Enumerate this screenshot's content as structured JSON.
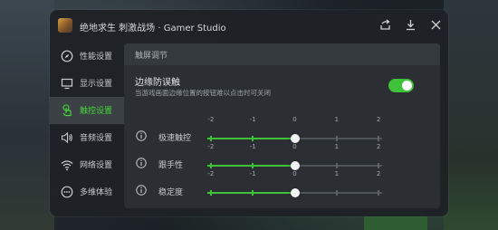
{
  "app": {
    "title": "绝地求生 刺激战场 · Gamer Studio"
  },
  "header": {
    "share_icon": "share-icon",
    "download_icon": "download-icon",
    "close_icon": "close-icon"
  },
  "sidebar": {
    "items": [
      {
        "label": "性能设置",
        "icon": "compass-icon",
        "active": false
      },
      {
        "label": "显示设置",
        "icon": "monitor-icon",
        "active": false
      },
      {
        "label": "触控设置",
        "icon": "touch-hand-icon",
        "active": true
      },
      {
        "label": "音频设置",
        "icon": "speaker-icon",
        "active": false
      },
      {
        "label": "网络设置",
        "icon": "wifi-icon",
        "active": false
      },
      {
        "label": "多维体验",
        "icon": "more-dots-icon",
        "active": false
      }
    ]
  },
  "section": {
    "title": "触屏调节"
  },
  "edge_guard": {
    "title": "边缘防误触",
    "description": "当游戏画面边缘位置的按钮难以点击时可关闭",
    "enabled": true
  },
  "sliders": [
    {
      "label": "极速触控",
      "ticks": [
        "-2",
        "-1",
        "0",
        "1",
        "2"
      ],
      "value": 0
    },
    {
      "label": "跟手性",
      "ticks": [
        "-2",
        "-1",
        "0",
        "1",
        "2"
      ],
      "value": 0
    },
    {
      "label": "稳定度",
      "ticks": [
        "-2",
        "-1",
        "0",
        "1",
        "2"
      ],
      "value": 0
    }
  ],
  "colors": {
    "accent": "#3fc23a",
    "panel": "#1e2125",
    "content": "#2b2f33"
  }
}
